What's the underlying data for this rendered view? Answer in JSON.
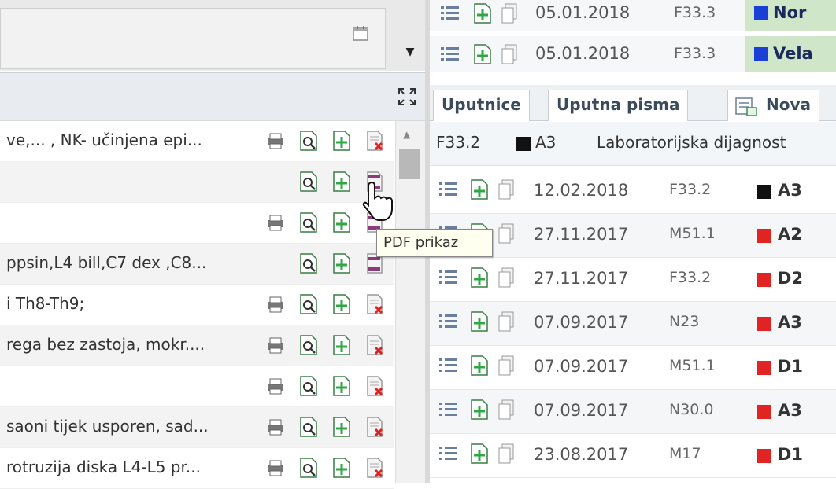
{
  "left_panel": {
    "rows": [
      {
        "text": "ve,... , NK- učinjena epi...",
        "icons": [
          "print",
          "preview",
          "add",
          "pdf-delete"
        ]
      },
      {
        "text": "",
        "icons": [
          "preview",
          "add",
          "pdf"
        ]
      },
      {
        "text": "",
        "icons": [
          "print",
          "preview",
          "add",
          "pdf"
        ]
      },
      {
        "text": "ppsin,L4 bill,C7 dex ,C8...",
        "icons": [
          "preview",
          "add",
          "pdf"
        ]
      },
      {
        "text": "i Th8-Th9;",
        "icons": [
          "print",
          "preview",
          "add",
          "pdf-delete"
        ]
      },
      {
        "text": "rega bez zastoja, mokr....",
        "icons": [
          "print",
          "preview",
          "add",
          "pdf-delete"
        ]
      },
      {
        "text": "",
        "icons": [
          "print",
          "preview",
          "add",
          "pdf-delete"
        ]
      },
      {
        "text": "saoni tijek usporen, sad...",
        "icons": [
          "print",
          "preview",
          "add",
          "pdf-delete"
        ]
      },
      {
        "text": "rotruzija diska L4-L5 pr...",
        "icons": [
          "print",
          "preview",
          "add",
          "pdf-delete"
        ]
      }
    ],
    "tooltip": "PDF prikaz"
  },
  "right_panel": {
    "top_rows": [
      {
        "date": "05.01.2018",
        "code": "F33.3",
        "tag": "Nor",
        "tag_color": "#1a3fd6"
      },
      {
        "date": "05.01.2018",
        "code": "F33.3",
        "tag": "Vela",
        "tag_color": "#1a3fd6"
      }
    ],
    "tabs": [
      {
        "label": "Uputnice",
        "active": true
      },
      {
        "label": "Uputna pisma",
        "active": false
      },
      {
        "label": "Nova",
        "active": false
      }
    ],
    "filter": {
      "code": "F33.2",
      "tag": "A3",
      "tag_color": "#111111",
      "description": "Laboratorijska dijagnost"
    },
    "rows": [
      {
        "date": "12.02.2018",
        "code": "F33.2",
        "tag": "A3",
        "tag_color": "#111111"
      },
      {
        "date": "27.11.2017",
        "code": "M51.1",
        "tag": "A2",
        "tag_color": "#e02424"
      },
      {
        "date": "27.11.2017",
        "code": "F33.2",
        "tag": "D2",
        "tag_color": "#e02424"
      },
      {
        "date": "07.09.2017",
        "code": "N23",
        "tag": "A3",
        "tag_color": "#e02424"
      },
      {
        "date": "07.09.2017",
        "code": "M51.1",
        "tag": "D1",
        "tag_color": "#e02424"
      },
      {
        "date": "07.09.2017",
        "code": "N30.0",
        "tag": "A3",
        "tag_color": "#e02424"
      },
      {
        "date": "23.08.2017",
        "code": "M17",
        "tag": "D1",
        "tag_color": "#e02424"
      }
    ]
  }
}
